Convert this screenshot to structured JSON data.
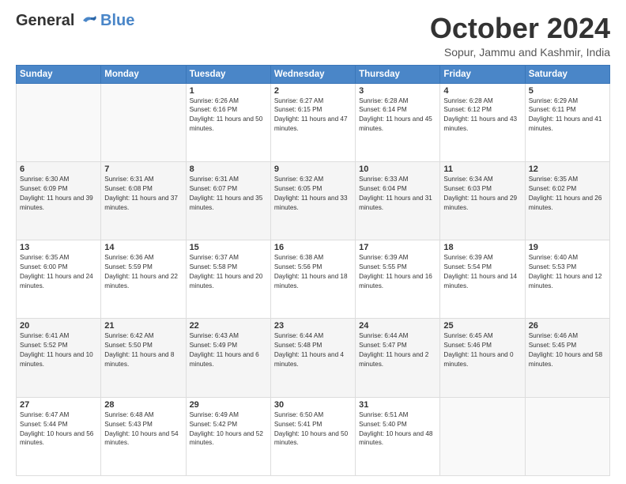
{
  "header": {
    "logo_line1": "General",
    "logo_line2": "Blue",
    "month": "October 2024",
    "location": "Sopur, Jammu and Kashmir, India"
  },
  "days_of_week": [
    "Sunday",
    "Monday",
    "Tuesday",
    "Wednesday",
    "Thursday",
    "Friday",
    "Saturday"
  ],
  "weeks": [
    [
      {
        "day": "",
        "info": ""
      },
      {
        "day": "",
        "info": ""
      },
      {
        "day": "1",
        "info": "Sunrise: 6:26 AM\nSunset: 6:16 PM\nDaylight: 11 hours and 50 minutes."
      },
      {
        "day": "2",
        "info": "Sunrise: 6:27 AM\nSunset: 6:15 PM\nDaylight: 11 hours and 47 minutes."
      },
      {
        "day": "3",
        "info": "Sunrise: 6:28 AM\nSunset: 6:14 PM\nDaylight: 11 hours and 45 minutes."
      },
      {
        "day": "4",
        "info": "Sunrise: 6:28 AM\nSunset: 6:12 PM\nDaylight: 11 hours and 43 minutes."
      },
      {
        "day": "5",
        "info": "Sunrise: 6:29 AM\nSunset: 6:11 PM\nDaylight: 11 hours and 41 minutes."
      }
    ],
    [
      {
        "day": "6",
        "info": "Sunrise: 6:30 AM\nSunset: 6:09 PM\nDaylight: 11 hours and 39 minutes."
      },
      {
        "day": "7",
        "info": "Sunrise: 6:31 AM\nSunset: 6:08 PM\nDaylight: 11 hours and 37 minutes."
      },
      {
        "day": "8",
        "info": "Sunrise: 6:31 AM\nSunset: 6:07 PM\nDaylight: 11 hours and 35 minutes."
      },
      {
        "day": "9",
        "info": "Sunrise: 6:32 AM\nSunset: 6:05 PM\nDaylight: 11 hours and 33 minutes."
      },
      {
        "day": "10",
        "info": "Sunrise: 6:33 AM\nSunset: 6:04 PM\nDaylight: 11 hours and 31 minutes."
      },
      {
        "day": "11",
        "info": "Sunrise: 6:34 AM\nSunset: 6:03 PM\nDaylight: 11 hours and 29 minutes."
      },
      {
        "day": "12",
        "info": "Sunrise: 6:35 AM\nSunset: 6:02 PM\nDaylight: 11 hours and 26 minutes."
      }
    ],
    [
      {
        "day": "13",
        "info": "Sunrise: 6:35 AM\nSunset: 6:00 PM\nDaylight: 11 hours and 24 minutes."
      },
      {
        "day": "14",
        "info": "Sunrise: 6:36 AM\nSunset: 5:59 PM\nDaylight: 11 hours and 22 minutes."
      },
      {
        "day": "15",
        "info": "Sunrise: 6:37 AM\nSunset: 5:58 PM\nDaylight: 11 hours and 20 minutes."
      },
      {
        "day": "16",
        "info": "Sunrise: 6:38 AM\nSunset: 5:56 PM\nDaylight: 11 hours and 18 minutes."
      },
      {
        "day": "17",
        "info": "Sunrise: 6:39 AM\nSunset: 5:55 PM\nDaylight: 11 hours and 16 minutes."
      },
      {
        "day": "18",
        "info": "Sunrise: 6:39 AM\nSunset: 5:54 PM\nDaylight: 11 hours and 14 minutes."
      },
      {
        "day": "19",
        "info": "Sunrise: 6:40 AM\nSunset: 5:53 PM\nDaylight: 11 hours and 12 minutes."
      }
    ],
    [
      {
        "day": "20",
        "info": "Sunrise: 6:41 AM\nSunset: 5:52 PM\nDaylight: 11 hours and 10 minutes."
      },
      {
        "day": "21",
        "info": "Sunrise: 6:42 AM\nSunset: 5:50 PM\nDaylight: 11 hours and 8 minutes."
      },
      {
        "day": "22",
        "info": "Sunrise: 6:43 AM\nSunset: 5:49 PM\nDaylight: 11 hours and 6 minutes."
      },
      {
        "day": "23",
        "info": "Sunrise: 6:44 AM\nSunset: 5:48 PM\nDaylight: 11 hours and 4 minutes."
      },
      {
        "day": "24",
        "info": "Sunrise: 6:44 AM\nSunset: 5:47 PM\nDaylight: 11 hours and 2 minutes."
      },
      {
        "day": "25",
        "info": "Sunrise: 6:45 AM\nSunset: 5:46 PM\nDaylight: 11 hours and 0 minutes."
      },
      {
        "day": "26",
        "info": "Sunrise: 6:46 AM\nSunset: 5:45 PM\nDaylight: 10 hours and 58 minutes."
      }
    ],
    [
      {
        "day": "27",
        "info": "Sunrise: 6:47 AM\nSunset: 5:44 PM\nDaylight: 10 hours and 56 minutes."
      },
      {
        "day": "28",
        "info": "Sunrise: 6:48 AM\nSunset: 5:43 PM\nDaylight: 10 hours and 54 minutes."
      },
      {
        "day": "29",
        "info": "Sunrise: 6:49 AM\nSunset: 5:42 PM\nDaylight: 10 hours and 52 minutes."
      },
      {
        "day": "30",
        "info": "Sunrise: 6:50 AM\nSunset: 5:41 PM\nDaylight: 10 hours and 50 minutes."
      },
      {
        "day": "31",
        "info": "Sunrise: 6:51 AM\nSunset: 5:40 PM\nDaylight: 10 hours and 48 minutes."
      },
      {
        "day": "",
        "info": ""
      },
      {
        "day": "",
        "info": ""
      }
    ]
  ]
}
